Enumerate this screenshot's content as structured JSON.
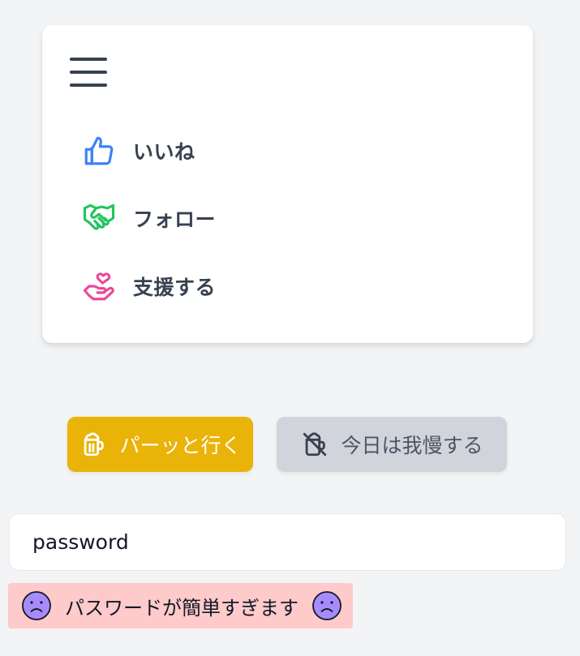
{
  "menu": {
    "items": [
      {
        "label": "いいね",
        "icon": "thumbs-up-icon",
        "color": "#3b82f6"
      },
      {
        "label": "フォロー",
        "icon": "handshake-icon",
        "color": "#22c55e"
      },
      {
        "label": "支援する",
        "icon": "heart-hand-icon",
        "color": "#ec4899"
      }
    ]
  },
  "actions": {
    "go_label": "パーッと行く",
    "go_icon": "beer-mug-icon",
    "stay_label": "今日は我慢する",
    "stay_icon": "beer-off-icon"
  },
  "password": {
    "value": "password"
  },
  "alert": {
    "message": "パスワードが簡単すぎます",
    "icon": "sad-face-icon"
  },
  "colors": {
    "go_button": "#eab308",
    "stay_button": "#d1d5db",
    "alert_bg": "#fecaca",
    "face": "#a78bfa"
  }
}
